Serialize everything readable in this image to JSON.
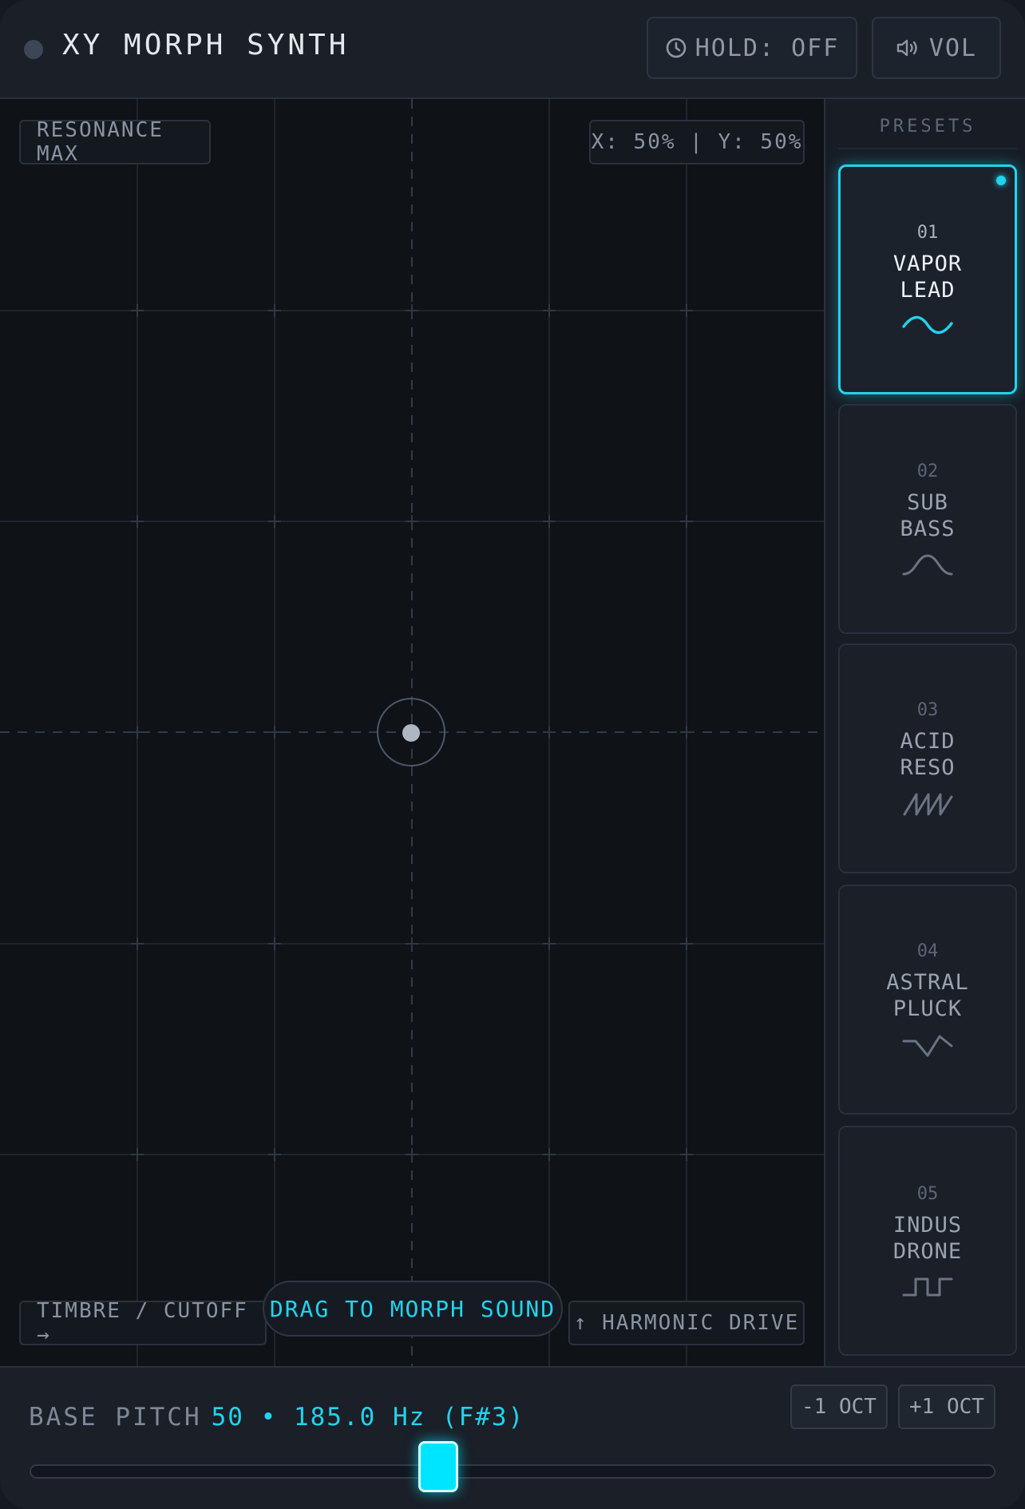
{
  "header": {
    "title": "XY MORPH SYNTH",
    "hold_label": "HOLD: OFF",
    "vol_label": "VOL"
  },
  "pad": {
    "top_left_label": "RESONANCE MAX",
    "coords_label": "X: 50% | Y: 50%",
    "x_axis_label": "TIMBRE / CUTOFF →",
    "y_axis_label": "↑  HARMONIC DRIVE",
    "drag_hint": "DRAG TO MORPH SOUND",
    "x_percent": 50,
    "y_percent": 50
  },
  "presets": {
    "title": "PRESETS",
    "items": [
      {
        "num": "01",
        "name": "VAPOR\nLEAD",
        "wave": "sine-wave-icon",
        "active": true
      },
      {
        "num": "02",
        "name": "SUB\nBASS",
        "wave": "arch-wave-icon",
        "active": false
      },
      {
        "num": "03",
        "name": "ACID\nRESO",
        "wave": "sawtooth-wave-icon",
        "active": false
      },
      {
        "num": "04",
        "name": "ASTRAL\nPLUCK",
        "wave": "triangle-wave-icon",
        "active": false
      },
      {
        "num": "05",
        "name": "INDUS\nDRONE",
        "wave": "square-wave-icon",
        "active": false
      }
    ]
  },
  "footer": {
    "pitch_label": "BASE PITCH",
    "pitch_value": "50 • 185.0 Hz (F#3)",
    "oct_down": "-1 OCT",
    "oct_up": "+1 OCT",
    "pitch_slider_fraction": 0.42
  },
  "colors": {
    "accent": "#22d3ee",
    "background": "#0f1217",
    "panel": "#1a1f28"
  }
}
